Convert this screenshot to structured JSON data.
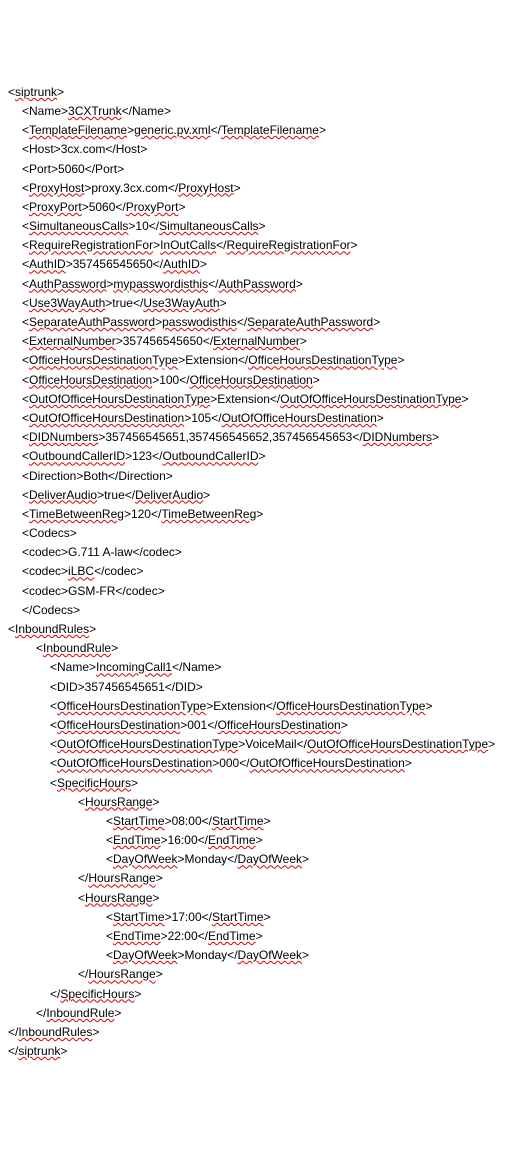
{
  "lines": [
    {
      "indent": 0,
      "segs": [
        {
          "t": "<",
          "u": 0
        },
        {
          "t": "siptrunk",
          "u": 1
        },
        {
          "t": ">",
          "u": 0
        }
      ]
    },
    {
      "indent": 1,
      "segs": [
        {
          "t": "<Name>",
          "u": 0
        },
        {
          "t": "3CXTrunk",
          "u": 1
        },
        {
          "t": "</Name>",
          "u": 0
        }
      ]
    },
    {
      "indent": 1,
      "segs": [
        {
          "t": "<",
          "u": 0
        },
        {
          "t": "TemplateFilename",
          "u": 1
        },
        {
          "t": ">",
          "u": 0
        },
        {
          "t": "generic.pv.xml",
          "u": 1
        },
        {
          "t": "</",
          "u": 0
        },
        {
          "t": "TemplateFilename",
          "u": 1
        },
        {
          "t": ">",
          "u": 0
        }
      ]
    },
    {
      "indent": 1,
      "segs": [
        {
          "t": "<Host>3cx.com</Host>",
          "u": 0
        }
      ]
    },
    {
      "indent": 1,
      "segs": [
        {
          "t": "<Port>5060</Port>",
          "u": 0
        }
      ]
    },
    {
      "indent": 1,
      "segs": [
        {
          "t": "<",
          "u": 0
        },
        {
          "t": "ProxyHost",
          "u": 1
        },
        {
          "t": ">proxy.3cx.com</",
          "u": 0
        },
        {
          "t": "ProxyHost",
          "u": 1
        },
        {
          "t": ">",
          "u": 0
        }
      ]
    },
    {
      "indent": 1,
      "segs": [
        {
          "t": "<",
          "u": 0
        },
        {
          "t": "ProxyPort",
          "u": 1
        },
        {
          "t": ">5060</",
          "u": 0
        },
        {
          "t": "ProxyPort",
          "u": 1
        },
        {
          "t": ">",
          "u": 0
        }
      ]
    },
    {
      "indent": 1,
      "segs": [
        {
          "t": "<",
          "u": 0
        },
        {
          "t": "SimultaneousCalls",
          "u": 1
        },
        {
          "t": ">10</",
          "u": 0
        },
        {
          "t": "SimultaneousCalls",
          "u": 1
        },
        {
          "t": ">",
          "u": 0
        }
      ]
    },
    {
      "indent": 1,
      "segs": [
        {
          "t": "<",
          "u": 0
        },
        {
          "t": "RequireRegistrationFor",
          "u": 1
        },
        {
          "t": ">",
          "u": 0
        },
        {
          "t": "InOutCalls",
          "u": 1
        },
        {
          "t": "</",
          "u": 0
        },
        {
          "t": "RequireRegistrationFor",
          "u": 1
        },
        {
          "t": ">",
          "u": 0
        }
      ]
    },
    {
      "indent": 1,
      "segs": [
        {
          "t": "<",
          "u": 0
        },
        {
          "t": "AuthID",
          "u": 1
        },
        {
          "t": ">357456545650</",
          "u": 0
        },
        {
          "t": "AuthID",
          "u": 1
        },
        {
          "t": ">",
          "u": 0
        }
      ]
    },
    {
      "indent": 1,
      "segs": [
        {
          "t": "<",
          "u": 0
        },
        {
          "t": "AuthPassword",
          "u": 1
        },
        {
          "t": ">",
          "u": 0
        },
        {
          "t": "mypasswordisthis",
          "u": 1
        },
        {
          "t": "</",
          "u": 0
        },
        {
          "t": "AuthPassword",
          "u": 1
        },
        {
          "t": ">",
          "u": 0
        }
      ]
    },
    {
      "indent": 1,
      "segs": [
        {
          "t": "<",
          "u": 0
        },
        {
          "t": "Use3WayAuth",
          "u": 1
        },
        {
          "t": ">true</",
          "u": 0
        },
        {
          "t": "Use3WayAuth",
          "u": 1
        },
        {
          "t": ">",
          "u": 0
        }
      ]
    },
    {
      "indent": 1,
      "segs": [
        {
          "t": "<",
          "u": 0
        },
        {
          "t": "SeparateAuthPassword",
          "u": 1
        },
        {
          "t": ">",
          "u": 0
        },
        {
          "t": "passwodisthis",
          "u": 1
        },
        {
          "t": "</",
          "u": 0
        },
        {
          "t": "SeparateAuthPassword",
          "u": 1
        },
        {
          "t": ">",
          "u": 0
        }
      ]
    },
    {
      "indent": 1,
      "segs": [
        {
          "t": "<",
          "u": 0
        },
        {
          "t": "ExternalNumber",
          "u": 1
        },
        {
          "t": ">357456545650</",
          "u": 0
        },
        {
          "t": "ExternalNumber",
          "u": 1
        },
        {
          "t": ">",
          "u": 0
        }
      ]
    },
    {
      "indent": 1,
      "segs": [
        {
          "t": "<",
          "u": 0
        },
        {
          "t": "OfficeHoursDestinationType",
          "u": 1
        },
        {
          "t": ">Extension</",
          "u": 0
        },
        {
          "t": "OfficeHoursDestinationType",
          "u": 1
        },
        {
          "t": ">",
          "u": 0
        }
      ]
    },
    {
      "indent": 1,
      "segs": [
        {
          "t": "<",
          "u": 0
        },
        {
          "t": "OfficeHoursDestination",
          "u": 1
        },
        {
          "t": ">100</",
          "u": 0
        },
        {
          "t": "OfficeHoursDestination",
          "u": 1
        },
        {
          "t": ">",
          "u": 0
        }
      ]
    },
    {
      "indent": 1,
      "segs": [
        {
          "t": "<",
          "u": 0
        },
        {
          "t": "OutOfOfficeHoursDestinationType",
          "u": 1
        },
        {
          "t": ">Extension</",
          "u": 0
        },
        {
          "t": "OutOfOfficeHoursDestinationType",
          "u": 1
        },
        {
          "t": ">",
          "u": 0
        }
      ]
    },
    {
      "indent": 1,
      "segs": [
        {
          "t": "<",
          "u": 0
        },
        {
          "t": "OutOfOfficeHoursDestination",
          "u": 1
        },
        {
          "t": ">105</",
          "u": 0
        },
        {
          "t": "OutOfOfficeHoursDestination",
          "u": 1
        },
        {
          "t": ">",
          "u": 0
        }
      ]
    },
    {
      "indent": 1,
      "segs": [
        {
          "t": "<",
          "u": 0
        },
        {
          "t": "DIDNumbers",
          "u": 1
        },
        {
          "t": ">357456545651,357456545652,357456545653</",
          "u": 0
        },
        {
          "t": "DIDNumbers",
          "u": 1
        },
        {
          "t": ">",
          "u": 0
        }
      ]
    },
    {
      "indent": 1,
      "segs": [
        {
          "t": "<",
          "u": 0
        },
        {
          "t": "OutboundCallerID",
          "u": 1
        },
        {
          "t": ">123</",
          "u": 0
        },
        {
          "t": "OutboundCallerID",
          "u": 1
        },
        {
          "t": ">",
          "u": 0
        }
      ]
    },
    {
      "indent": 1,
      "segs": [
        {
          "t": "<Direction>Both</Direction>",
          "u": 0
        }
      ]
    },
    {
      "indent": 1,
      "segs": [
        {
          "t": "<",
          "u": 0
        },
        {
          "t": "DeliverAudio",
          "u": 1
        },
        {
          "t": ">true</",
          "u": 0
        },
        {
          "t": "DeliverAudio",
          "u": 1
        },
        {
          "t": ">",
          "u": 0
        }
      ]
    },
    {
      "indent": 1,
      "segs": [
        {
          "t": "<",
          "u": 0
        },
        {
          "t": "TimeBetweenReg",
          "u": 1
        },
        {
          "t": ">120</",
          "u": 0
        },
        {
          "t": "TimeBetweenReg",
          "u": 1
        },
        {
          "t": ">",
          "u": 0
        }
      ]
    },
    {
      "indent": 1,
      "segs": [
        {
          "t": "<Codecs>",
          "u": 0
        }
      ]
    },
    {
      "indent": 1,
      "segs": [
        {
          "t": "<codec>G.711 A-law</codec>",
          "u": 0
        }
      ]
    },
    {
      "indent": 1,
      "segs": [
        {
          "t": "<codec>",
          "u": 0
        },
        {
          "t": "iLBC",
          "u": 1
        },
        {
          "t": "</codec>",
          "u": 0
        }
      ]
    },
    {
      "indent": 1,
      "segs": [
        {
          "t": "<codec>GSM-FR</codec>",
          "u": 0
        }
      ]
    },
    {
      "indent": 1,
      "segs": [
        {
          "t": "</Codecs>",
          "u": 0
        }
      ]
    },
    {
      "indent": 0,
      "segs": [
        {
          "t": "<",
          "u": 0
        },
        {
          "t": "InboundRules",
          "u": 1
        },
        {
          "t": ">",
          "u": 0
        }
      ]
    },
    {
      "indent": 2,
      "segs": [
        {
          "t": "<",
          "u": 0
        },
        {
          "t": "InboundRule",
          "u": 1
        },
        {
          "t": ">",
          "u": 0
        }
      ]
    },
    {
      "indent": 3,
      "segs": [
        {
          "t": "<Name>",
          "u": 0
        },
        {
          "t": "IncomingCall1",
          "u": 1
        },
        {
          "t": "</Name>",
          "u": 0
        }
      ]
    },
    {
      "indent": 3,
      "segs": [
        {
          "t": "<DID>357456545651</DID>",
          "u": 0
        }
      ]
    },
    {
      "indent": 3,
      "segs": [
        {
          "t": "<",
          "u": 0
        },
        {
          "t": "OfficeHoursDestinationType",
          "u": 1
        },
        {
          "t": ">Extension</",
          "u": 0
        },
        {
          "t": "OfficeHoursDestinationType",
          "u": 1
        },
        {
          "t": ">",
          "u": 0
        }
      ]
    },
    {
      "indent": 3,
      "segs": [
        {
          "t": "<",
          "u": 0
        },
        {
          "t": "OfficeHoursDestination",
          "u": 1
        },
        {
          "t": ">001</",
          "u": 0
        },
        {
          "t": "OfficeHoursDestination",
          "u": 1
        },
        {
          "t": ">",
          "u": 0
        }
      ]
    },
    {
      "indent": 3,
      "segs": [
        {
          "t": "<",
          "u": 0
        },
        {
          "t": "OutOfOfficeHoursDestinationType",
          "u": 1
        },
        {
          "t": ">VoiceMail</",
          "u": 0
        },
        {
          "t": "OutOfOfficeHoursDestinationType",
          "u": 1
        },
        {
          "t": ">",
          "u": 0
        }
      ]
    },
    {
      "indent": 3,
      "segs": [
        {
          "t": "<",
          "u": 0
        },
        {
          "t": "OutOfOfficeHoursDestination",
          "u": 1
        },
        {
          "t": ">000</",
          "u": 0
        },
        {
          "t": "OutOfOfficeHoursDestination",
          "u": 1
        },
        {
          "t": ">",
          "u": 0
        }
      ]
    },
    {
      "indent": 3,
      "segs": [
        {
          "t": "<",
          "u": 0
        },
        {
          "t": "SpecificHours",
          "u": 1
        },
        {
          "t": ">",
          "u": 0
        }
      ]
    },
    {
      "indent": 5,
      "segs": [
        {
          "t": "<",
          "u": 0
        },
        {
          "t": "HoursRange",
          "u": 1
        },
        {
          "t": ">",
          "u": 0
        }
      ]
    },
    {
      "indent": 7,
      "segs": [
        {
          "t": "<",
          "u": 0
        },
        {
          "t": "StartTime",
          "u": 1
        },
        {
          "t": ">08:00</",
          "u": 0
        },
        {
          "t": "StartTime",
          "u": 1
        },
        {
          "t": ">",
          "u": 0
        }
      ]
    },
    {
      "indent": 7,
      "segs": [
        {
          "t": "<",
          "u": 0
        },
        {
          "t": "EndTime",
          "u": 1
        },
        {
          "t": ">16:00</",
          "u": 0
        },
        {
          "t": "EndTime",
          "u": 1
        },
        {
          "t": ">",
          "u": 0
        }
      ]
    },
    {
      "indent": 7,
      "segs": [
        {
          "t": "<",
          "u": 0
        },
        {
          "t": "DayOfWeek",
          "u": 1
        },
        {
          "t": ">Monday</",
          "u": 0
        },
        {
          "t": "DayOfWeek",
          "u": 1
        },
        {
          "t": ">",
          "u": 0
        }
      ]
    },
    {
      "indent": 5,
      "segs": [
        {
          "t": "</",
          "u": 0
        },
        {
          "t": "HoursRange",
          "u": 1
        },
        {
          "t": ">",
          "u": 0
        }
      ]
    },
    {
      "indent": 5,
      "segs": [
        {
          "t": "<",
          "u": 0
        },
        {
          "t": "HoursRange",
          "u": 1
        },
        {
          "t": ">",
          "u": 0
        }
      ]
    },
    {
      "indent": 7,
      "segs": [
        {
          "t": "<",
          "u": 0
        },
        {
          "t": "StartTime",
          "u": 1
        },
        {
          "t": ">17:00</",
          "u": 0
        },
        {
          "t": "StartTime",
          "u": 1
        },
        {
          "t": ">",
          "u": 0
        }
      ]
    },
    {
      "indent": 7,
      "segs": [
        {
          "t": "<",
          "u": 0
        },
        {
          "t": "EndTime",
          "u": 1
        },
        {
          "t": ">22:00</",
          "u": 0
        },
        {
          "t": "EndTime",
          "u": 1
        },
        {
          "t": ">",
          "u": 0
        }
      ]
    },
    {
      "indent": 7,
      "segs": [
        {
          "t": "<",
          "u": 0
        },
        {
          "t": "DayOfWeek",
          "u": 1
        },
        {
          "t": ">Monday</",
          "u": 0
        },
        {
          "t": "DayOfWeek",
          "u": 1
        },
        {
          "t": ">",
          "u": 0
        }
      ]
    },
    {
      "indent": 5,
      "segs": [
        {
          "t": "</",
          "u": 0
        },
        {
          "t": "HoursRange",
          "u": 1
        },
        {
          "t": ">",
          "u": 0
        }
      ]
    },
    {
      "indent": 3,
      "segs": [
        {
          "t": "</",
          "u": 0
        },
        {
          "t": "SpecificHours",
          "u": 1
        },
        {
          "t": ">",
          "u": 0
        }
      ]
    },
    {
      "indent": 2,
      "segs": [
        {
          "t": "</",
          "u": 0
        },
        {
          "t": "InboundRule",
          "u": 1
        },
        {
          "t": ">",
          "u": 0
        }
      ]
    },
    {
      "indent": 0,
      "segs": [
        {
          "t": "</",
          "u": 0
        },
        {
          "t": "InboundRules",
          "u": 1
        },
        {
          "t": ">",
          "u": 0
        }
      ]
    },
    {
      "indent": 0,
      "segs": [
        {
          "t": "</",
          "u": 0
        },
        {
          "t": "siptrunk",
          "u": 1
        },
        {
          "t": ">",
          "u": 0
        }
      ]
    }
  ]
}
